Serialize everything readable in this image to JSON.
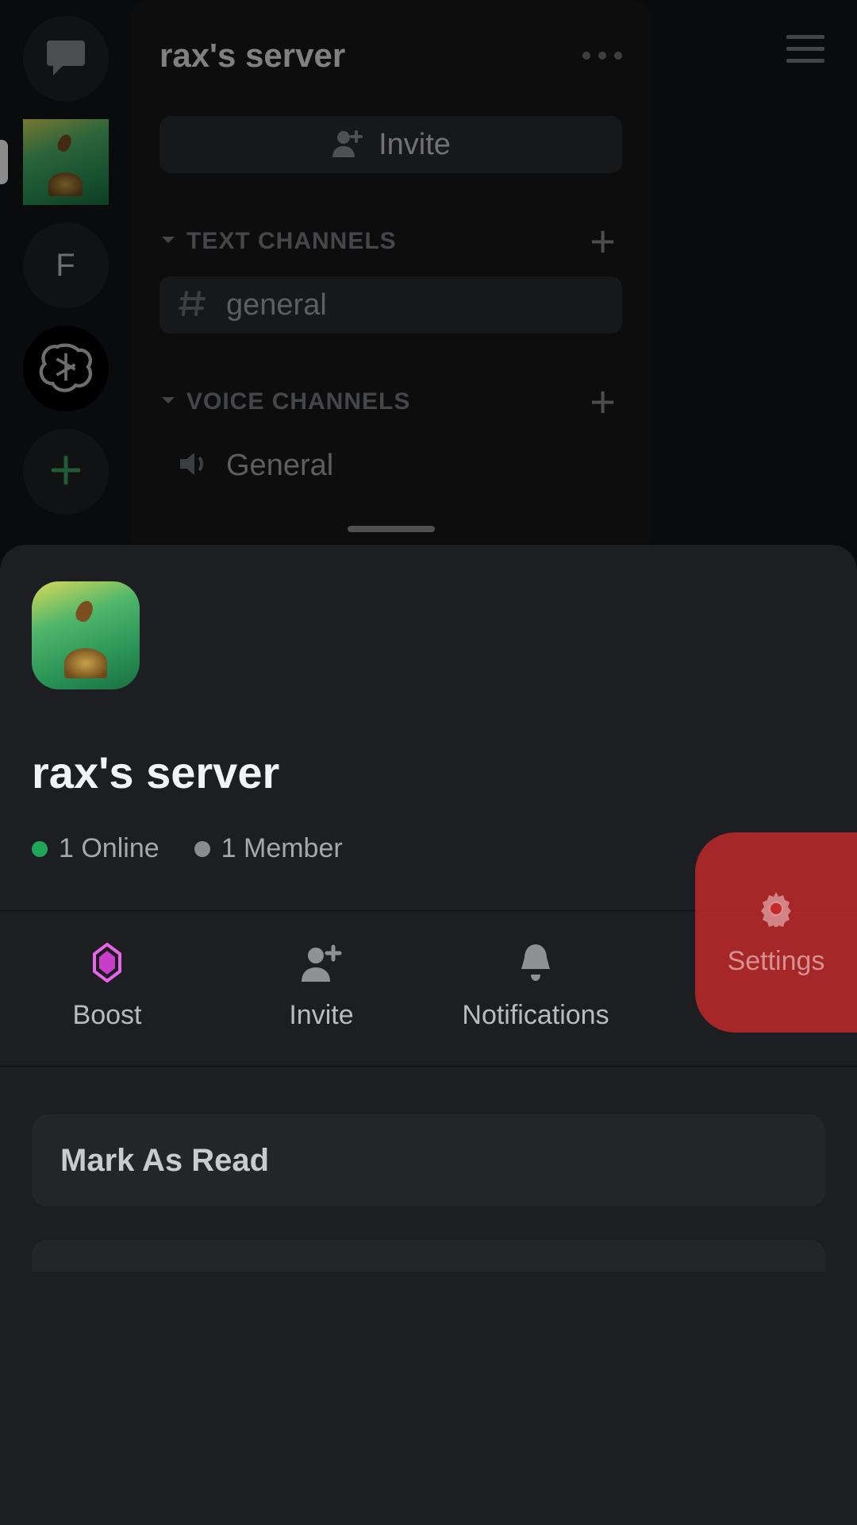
{
  "header": {
    "server_name": "rax's server"
  },
  "invite": {
    "label": "Invite"
  },
  "categories": {
    "text_label": "TEXT CHANNELS",
    "voice_label": "VOICE CHANNELS"
  },
  "channels": {
    "text_general": "general",
    "voice_general": "General"
  },
  "rail": {
    "server_letter": "F"
  },
  "sheet": {
    "server_name": "rax's server",
    "online_text": "1 Online",
    "member_text": "1 Member",
    "actions": {
      "boost": "Boost",
      "invite": "Invite",
      "notifications": "Notifications",
      "settings": "Settings"
    },
    "mark_as_read": "Mark As Read"
  }
}
